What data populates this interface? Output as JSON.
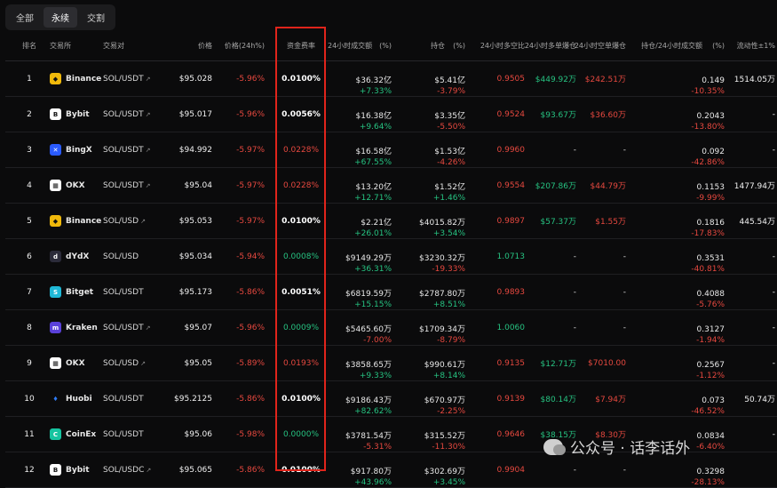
{
  "tabs": [
    {
      "label": "全部",
      "active": false
    },
    {
      "label": "永续",
      "active": true
    },
    {
      "label": "交割",
      "active": false
    }
  ],
  "headers": {
    "rank": "排名",
    "exchange": "交易所",
    "pair": "交易对",
    "price": "价格",
    "change": "价格(24h%)",
    "funding": "资金费率",
    "volume": "24小时成交额",
    "volume_pct": "(%)",
    "oi": "持仓",
    "oi_pct": "(%)",
    "ls_ratio": "24小时多空比",
    "long_liq": "24小时多单爆仓",
    "short_liq": "24小时空单爆仓",
    "oi_vol": "持仓/24小时成交额",
    "oi_vol_pct": "(%)",
    "liquidity": "流动性±1%"
  },
  "rows": [
    {
      "rank": "1",
      "exchange": "Binance",
      "logo": "binance",
      "pair": "SOL/USDT",
      "ext": true,
      "price": "$95.028",
      "change": "-5.96%",
      "funding": "0.0100%",
      "funding_color": "white",
      "volume": "$36.32亿",
      "volume_pct": "+7.33%",
      "volume_pct_color": "green",
      "oi": "$5.41亿",
      "oi_pct": "-3.79%",
      "oi_pct_color": "red",
      "ls": "0.9505",
      "ls_color": "red",
      "long_liq": "$449.92万",
      "short_liq": "$242.51万",
      "oi_vol": "0.149",
      "oi_vol_pct": "-10.35%",
      "oi_vol_pct_color": "red",
      "liquidity": "1514.05万"
    },
    {
      "rank": "2",
      "exchange": "Bybit",
      "logo": "bybit",
      "pair": "SOL/USDT",
      "ext": true,
      "price": "$95.017",
      "change": "-5.96%",
      "funding": "0.0056%",
      "funding_color": "white",
      "volume": "$16.38亿",
      "volume_pct": "+9.64%",
      "volume_pct_color": "green",
      "oi": "$3.35亿",
      "oi_pct": "-5.50%",
      "oi_pct_color": "red",
      "ls": "0.9524",
      "ls_color": "red",
      "long_liq": "$93.67万",
      "short_liq": "$36.60万",
      "oi_vol": "0.2043",
      "oi_vol_pct": "-13.80%",
      "oi_vol_pct_color": "red",
      "liquidity": "-"
    },
    {
      "rank": "3",
      "exchange": "BingX",
      "logo": "bingx",
      "pair": "SOL/USDT",
      "ext": true,
      "price": "$94.992",
      "change": "-5.97%",
      "funding": "0.0228%",
      "funding_color": "red",
      "volume": "$16.58亿",
      "volume_pct": "+67.55%",
      "volume_pct_color": "green",
      "oi": "$1.53亿",
      "oi_pct": "-4.26%",
      "oi_pct_color": "red",
      "ls": "0.9960",
      "ls_color": "red",
      "long_liq": "-",
      "short_liq": "-",
      "oi_vol": "0.092",
      "oi_vol_pct": "-42.86%",
      "oi_vol_pct_color": "red",
      "liquidity": "-"
    },
    {
      "rank": "4",
      "exchange": "OKX",
      "logo": "okx",
      "pair": "SOL/USDT",
      "ext": true,
      "price": "$95.04",
      "change": "-5.97%",
      "funding": "0.0228%",
      "funding_color": "red",
      "volume": "$13.20亿",
      "volume_pct": "+12.71%",
      "volume_pct_color": "green",
      "oi": "$1.52亿",
      "oi_pct": "+1.46%",
      "oi_pct_color": "green",
      "ls": "0.9554",
      "ls_color": "red",
      "long_liq": "$207.86万",
      "short_liq": "$44.79万",
      "oi_vol": "0.1153",
      "oi_vol_pct": "-9.99%",
      "oi_vol_pct_color": "red",
      "liquidity": "1477.94万"
    },
    {
      "rank": "5",
      "exchange": "Binance",
      "logo": "binance",
      "pair": "SOL/USD",
      "ext": true,
      "price": "$95.053",
      "change": "-5.97%",
      "funding": "0.0100%",
      "funding_color": "white",
      "volume": "$2.21亿",
      "volume_pct": "+26.01%",
      "volume_pct_color": "green",
      "oi": "$4015.82万",
      "oi_pct": "+3.54%",
      "oi_pct_color": "green",
      "ls": "0.9897",
      "ls_color": "red",
      "long_liq": "$57.37万",
      "short_liq": "$1.55万",
      "oi_vol": "0.1816",
      "oi_vol_pct": "-17.83%",
      "oi_vol_pct_color": "red",
      "liquidity": "445.54万"
    },
    {
      "rank": "6",
      "exchange": "dYdX",
      "logo": "dydx",
      "pair": "SOL/USD",
      "ext": false,
      "price": "$95.034",
      "change": "-5.94%",
      "funding": "0.0008%",
      "funding_color": "green",
      "volume": "$9149.29万",
      "volume_pct": "+36.31%",
      "volume_pct_color": "green",
      "oi": "$3230.32万",
      "oi_pct": "-19.33%",
      "oi_pct_color": "red",
      "ls": "1.0713",
      "ls_color": "green",
      "long_liq": "-",
      "short_liq": "-",
      "oi_vol": "0.3531",
      "oi_vol_pct": "-40.81%",
      "oi_vol_pct_color": "red",
      "liquidity": "-"
    },
    {
      "rank": "7",
      "exchange": "Bitget",
      "logo": "bitget",
      "pair": "SOL/USDT",
      "ext": false,
      "price": "$95.173",
      "change": "-5.86%",
      "funding": "0.0051%",
      "funding_color": "white",
      "volume": "$6819.59万",
      "volume_pct": "+15.15%",
      "volume_pct_color": "green",
      "oi": "$2787.80万",
      "oi_pct": "+8.51%",
      "oi_pct_color": "green",
      "ls": "0.9893",
      "ls_color": "red",
      "long_liq": "-",
      "short_liq": "-",
      "oi_vol": "0.4088",
      "oi_vol_pct": "-5.76%",
      "oi_vol_pct_color": "red",
      "liquidity": "-"
    },
    {
      "rank": "8",
      "exchange": "Kraken",
      "logo": "kraken",
      "pair": "SOL/USDT",
      "ext": true,
      "price": "$95.07",
      "change": "-5.96%",
      "funding": "0.0009%",
      "funding_color": "green",
      "volume": "$5465.60万",
      "volume_pct": "-7.00%",
      "volume_pct_color": "red",
      "oi": "$1709.34万",
      "oi_pct": "-8.79%",
      "oi_pct_color": "red",
      "ls": "1.0060",
      "ls_color": "green",
      "long_liq": "-",
      "short_liq": "-",
      "oi_vol": "0.3127",
      "oi_vol_pct": "-1.94%",
      "oi_vol_pct_color": "red",
      "liquidity": "-"
    },
    {
      "rank": "9",
      "exchange": "OKX",
      "logo": "okx",
      "pair": "SOL/USD",
      "ext": true,
      "price": "$95.05",
      "change": "-5.89%",
      "funding": "0.0193%",
      "funding_color": "red",
      "volume": "$3858.65万",
      "volume_pct": "+9.33%",
      "volume_pct_color": "green",
      "oi": "$990.61万",
      "oi_pct": "+8.14%",
      "oi_pct_color": "green",
      "ls": "0.9135",
      "ls_color": "red",
      "long_liq": "$12.71万",
      "short_liq": "$7010.00",
      "oi_vol": "0.2567",
      "oi_vol_pct": "-1.12%",
      "oi_vol_pct_color": "red",
      "liquidity": "-"
    },
    {
      "rank": "10",
      "exchange": "Huobi",
      "logo": "huobi",
      "pair": "SOL/USDT",
      "ext": false,
      "price": "$95.2125",
      "change": "-5.86%",
      "funding": "0.0100%",
      "funding_color": "white",
      "volume": "$9186.43万",
      "volume_pct": "+82.62%",
      "volume_pct_color": "green",
      "oi": "$670.97万",
      "oi_pct": "-2.25%",
      "oi_pct_color": "red",
      "ls": "0.9139",
      "ls_color": "red",
      "long_liq": "$80.14万",
      "short_liq": "$7.94万",
      "oi_vol": "0.073",
      "oi_vol_pct": "-46.52%",
      "oi_vol_pct_color": "red",
      "liquidity": "50.74万"
    },
    {
      "rank": "11",
      "exchange": "CoinEx",
      "logo": "coinex",
      "pair": "SOL/USDT",
      "ext": false,
      "price": "$95.06",
      "change": "-5.98%",
      "funding": "0.0000%",
      "funding_color": "green",
      "volume": "$3781.54万",
      "volume_pct": "-5.31%",
      "volume_pct_color": "red",
      "oi": "$315.52万",
      "oi_pct": "-11.30%",
      "oi_pct_color": "red",
      "ls": "0.9646",
      "ls_color": "red",
      "long_liq": "$38.15万",
      "short_liq": "$8.30万",
      "oi_vol": "0.0834",
      "oi_vol_pct": "-6.40%",
      "oi_vol_pct_color": "red",
      "liquidity": "-"
    },
    {
      "rank": "12",
      "exchange": "Bybit",
      "logo": "bybit",
      "pair": "SOL/USDC",
      "ext": true,
      "price": "$95.065",
      "change": "-5.86%",
      "funding": "0.0100%",
      "funding_color": "white",
      "volume": "$917.80万",
      "volume_pct": "+43.96%",
      "volume_pct_color": "green",
      "oi": "$302.69万",
      "oi_pct": "+3.45%",
      "oi_pct_color": "green",
      "ls": "0.9904",
      "ls_color": "red",
      "long_liq": "-",
      "short_liq": "-",
      "oi_vol": "0.3298",
      "oi_vol_pct": "-28.13%",
      "oi_vol_pct_color": "red",
      "liquidity": ""
    }
  ],
  "logos": {
    "binance": {
      "bg": "#f0b90b",
      "fg": "#111111",
      "glyph": "◆"
    },
    "bybit": {
      "bg": "#ffffff",
      "fg": "#111111",
      "glyph": "B"
    },
    "bingx": {
      "bg": "#2a5bff",
      "fg": "#ffffff",
      "glyph": "✕"
    },
    "okx": {
      "bg": "#ffffff",
      "fg": "#111111",
      "glyph": "▦"
    },
    "dydx": {
      "bg": "#2b2b3a",
      "fg": "#ffffff",
      "glyph": "d"
    },
    "bitget": {
      "bg": "#1fb8d6",
      "fg": "#ffffff",
      "glyph": "S"
    },
    "kraken": {
      "bg": "#5a41d9",
      "fg": "#ffffff",
      "glyph": "m"
    },
    "huobi": {
      "bg": "#0b0b0c",
      "fg": "#2e7bf6",
      "glyph": "♦"
    },
    "coinex": {
      "bg": "#16c4a0",
      "fg": "#ffffff",
      "glyph": "C"
    }
  },
  "colors": {
    "green": "#26c281",
    "red": "#e5483f",
    "white": "#f0f0f0",
    "highlight": "#e0241b"
  },
  "watermark": {
    "text": "公众号 · 话李话外"
  }
}
